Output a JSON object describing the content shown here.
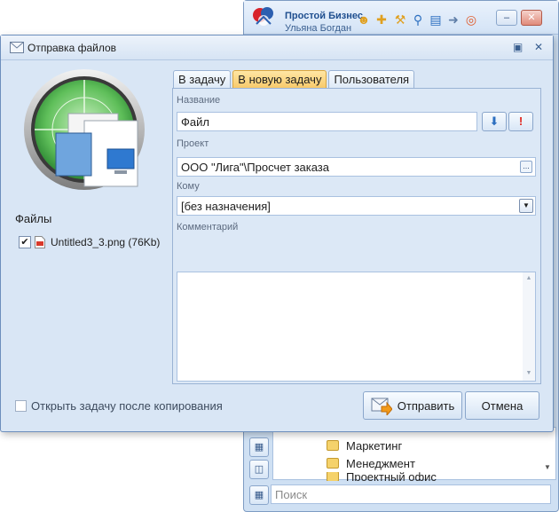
{
  "app": {
    "name": "Простой Бизнес",
    "user": "Ульяна Богдан",
    "toolbar_icons": [
      "user-icon",
      "add-icon",
      "wrench-icon",
      "search-icon",
      "calendar-icon",
      "arrow-right-icon",
      "lifebuoy-icon"
    ],
    "tree_items": [
      "Маркетинг",
      "Менеджмент",
      "Проектный офис"
    ],
    "search_placeholder": "Поиск"
  },
  "dialog": {
    "title": "Отправка файлов",
    "files_label": "Файлы",
    "files": [
      {
        "name": "Untitled3_3.png (76Kb)",
        "checked": true
      }
    ],
    "tabs": [
      {
        "label": "В задачу",
        "active": false
      },
      {
        "label": "В новую задачу",
        "active": true
      },
      {
        "label": "Пользователя",
        "active": false
      }
    ],
    "form": {
      "name_label": "Название",
      "name_value": "Файл",
      "project_label": "Проект",
      "project_value": "ООО \"Лига\"\\Просчет заказа",
      "to_label": "Кому",
      "to_value": "[без назначения]",
      "comment_label": "Комментарий",
      "comment_value": ""
    },
    "open_after_copy_label": "Открыть задачу после копирования",
    "open_after_copy_checked": false,
    "send_label": "Отправить",
    "cancel_label": "Отмена"
  },
  "colors": {
    "accent_tab": "#f7c766",
    "dialog_bg": "#d9e6f5",
    "border": "#6d8fbd"
  }
}
